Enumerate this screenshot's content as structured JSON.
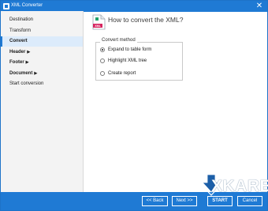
{
  "window": {
    "title": "XML Converter",
    "close_glyph": "✕"
  },
  "sidebar": {
    "items": [
      {
        "label": "Destination",
        "bold": false,
        "active": false,
        "caret": ""
      },
      {
        "label": "Transform",
        "bold": false,
        "active": false,
        "caret": ""
      },
      {
        "label": "Convert",
        "bold": true,
        "active": true,
        "caret": ""
      },
      {
        "label": "Header",
        "bold": true,
        "active": false,
        "caret": "▶"
      },
      {
        "label": "Footer",
        "bold": true,
        "active": false,
        "caret": "▶"
      },
      {
        "label": "Document",
        "bold": true,
        "active": false,
        "caret": "▶"
      },
      {
        "label": "Start conversion",
        "bold": false,
        "active": false,
        "caret": ""
      }
    ]
  },
  "main": {
    "title": "How to convert the XML?",
    "icon_label": "XML",
    "group_label": "Convert method",
    "options": [
      {
        "label": "Expand to table form",
        "checked": true
      },
      {
        "label": "Highlight XML tree",
        "checked": false
      },
      {
        "label": "Create report",
        "checked": false
      }
    ]
  },
  "footer": {
    "back_label": "<< Back",
    "next_label": "Next >>",
    "start_label": "START",
    "cancel_label": "Cancel"
  },
  "brand": {
    "text": "XKARE"
  },
  "colors": {
    "accent": "#1f7ad4",
    "sidebar_bg": "#f3f3f3",
    "active_bg": "#dcebfb"
  }
}
